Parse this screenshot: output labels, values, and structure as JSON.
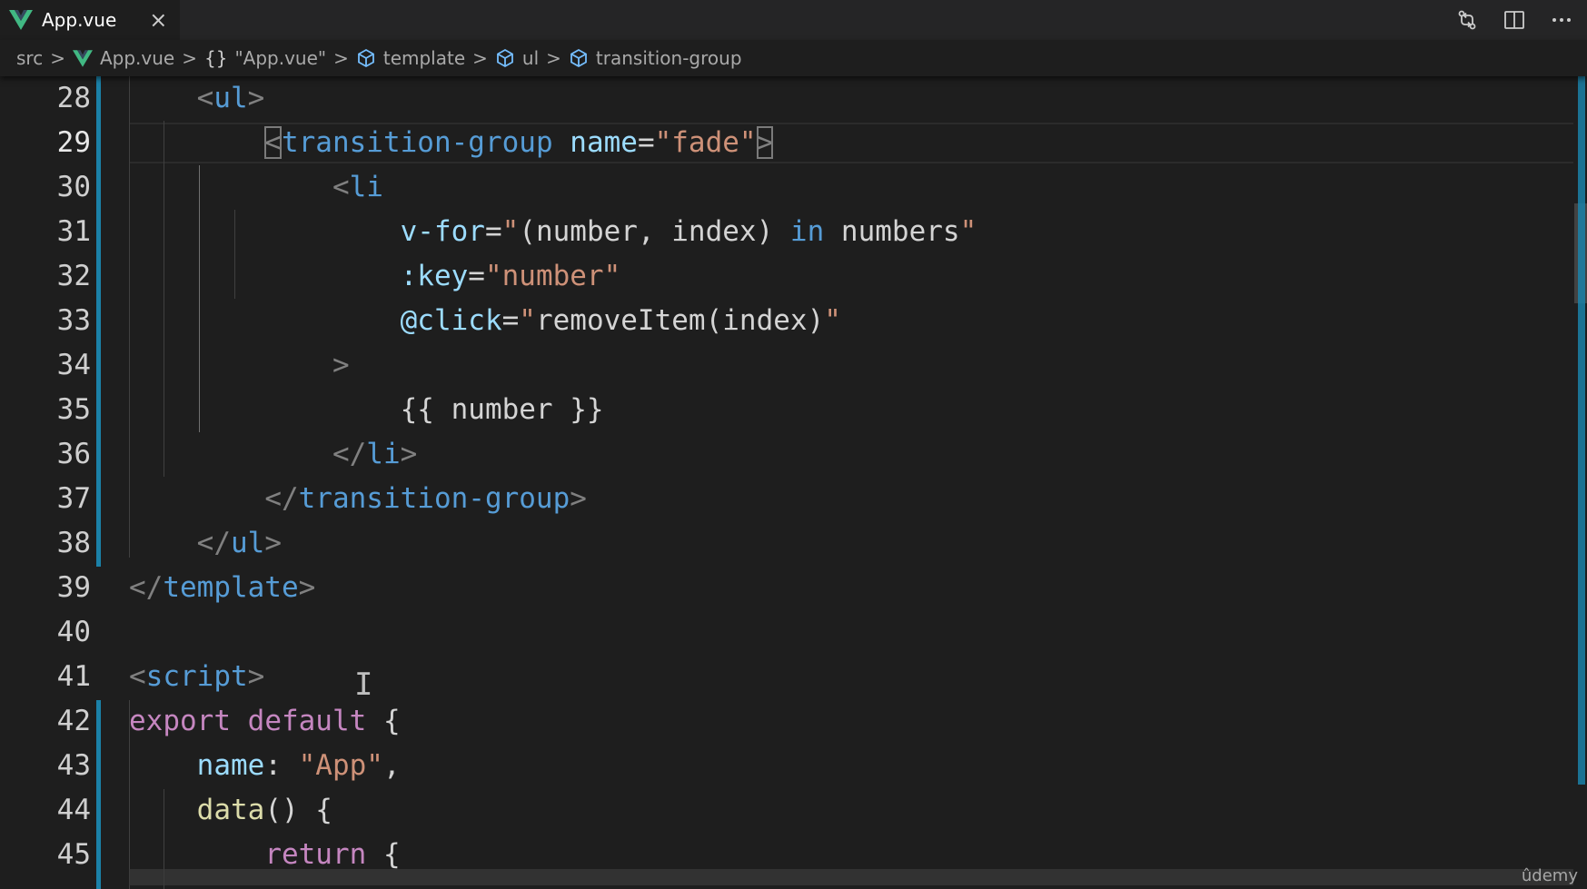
{
  "tab": {
    "filename": "App.vue",
    "close_glyph": "×"
  },
  "breadcrumb": {
    "items": [
      {
        "label": "src",
        "icon": ""
      },
      {
        "label": "App.vue",
        "icon": "vue-icon"
      },
      {
        "label": "\"App.vue\"",
        "icon": "braces-icon",
        "icon_text": "{}"
      },
      {
        "label": "template",
        "icon": "cube-icon"
      },
      {
        "label": "ul",
        "icon": "cube-icon"
      },
      {
        "label": "transition-group",
        "icon": "cube-icon"
      }
    ],
    "separator": ">"
  },
  "editor": {
    "line_numbers": [
      "28",
      "29",
      "30",
      "31",
      "32",
      "33",
      "34",
      "35",
      "36",
      "37",
      "38",
      "39",
      "40",
      "41",
      "42",
      "43",
      "44",
      "45"
    ],
    "active_line": "29",
    "lines": [
      {
        "indent": "  ",
        "tokens": [
          [
            "tg",
            "<"
          ],
          [
            "tn",
            "ul"
          ],
          [
            "tg",
            ">"
          ]
        ]
      },
      {
        "indent": "    ",
        "tokens": [
          [
            "tg",
            "<"
          ],
          [
            "tn",
            "transition-group"
          ],
          [
            "tx",
            " "
          ],
          [
            "at",
            "name"
          ],
          [
            "tx",
            "="
          ],
          [
            "st",
            "\"fade\""
          ],
          [
            "tg",
            ">"
          ]
        ]
      },
      {
        "indent": "      ",
        "tokens": [
          [
            "tg",
            "<"
          ],
          [
            "tn",
            "li"
          ]
        ]
      },
      {
        "indent": "        ",
        "tokens": [
          [
            "at",
            "v-for"
          ],
          [
            "tx",
            "="
          ],
          [
            "st",
            "\""
          ],
          [
            "tx",
            "(number, index) "
          ],
          [
            "bl",
            "in"
          ],
          [
            "tx",
            " numbers"
          ],
          [
            "st",
            "\""
          ]
        ]
      },
      {
        "indent": "        ",
        "tokens": [
          [
            "at",
            ":key"
          ],
          [
            "tx",
            "="
          ],
          [
            "st",
            "\"number\""
          ]
        ]
      },
      {
        "indent": "        ",
        "tokens": [
          [
            "at",
            "@click"
          ],
          [
            "tx",
            "="
          ],
          [
            "st",
            "\""
          ],
          [
            "tx",
            "removeItem(index)"
          ],
          [
            "st",
            "\""
          ]
        ]
      },
      {
        "indent": "      ",
        "tokens": [
          [
            "tg",
            ">"
          ]
        ]
      },
      {
        "indent": "        ",
        "tokens": [
          [
            "tx",
            "{{ number }}"
          ]
        ]
      },
      {
        "indent": "      ",
        "tokens": [
          [
            "tg",
            "</"
          ],
          [
            "tn",
            "li"
          ],
          [
            "tg",
            ">"
          ]
        ]
      },
      {
        "indent": "    ",
        "tokens": [
          [
            "tg",
            "</"
          ],
          [
            "tn",
            "transition-group"
          ],
          [
            "tg",
            ">"
          ]
        ]
      },
      {
        "indent": "  ",
        "tokens": [
          [
            "tg",
            "</"
          ],
          [
            "tn",
            "ul"
          ],
          [
            "tg",
            ">"
          ]
        ]
      },
      {
        "indent": "",
        "tokens": [
          [
            "tg",
            "</"
          ],
          [
            "tn",
            "template"
          ],
          [
            "tg",
            ">"
          ]
        ]
      },
      {
        "indent": "",
        "tokens": []
      },
      {
        "indent": "",
        "tokens": [
          [
            "tg",
            "<"
          ],
          [
            "tn",
            "script"
          ],
          [
            "tg",
            ">"
          ]
        ]
      },
      {
        "indent": "",
        "tokens": [
          [
            "kw",
            "export"
          ],
          [
            "tx",
            " "
          ],
          [
            "kw",
            "default"
          ],
          [
            "tx",
            " {"
          ]
        ]
      },
      {
        "indent": "  ",
        "tokens": [
          [
            "vr",
            "name"
          ],
          [
            "tx",
            ": "
          ],
          [
            "st",
            "\"App\""
          ],
          [
            "tx",
            ","
          ]
        ]
      },
      {
        "indent": "  ",
        "tokens": [
          [
            "fn",
            "data"
          ],
          [
            "tx",
            "() {"
          ]
        ]
      },
      {
        "indent": "    ",
        "tokens": [
          [
            "kw",
            "return"
          ],
          [
            "tx",
            " {"
          ]
        ]
      }
    ]
  },
  "colors": {
    "background": "#1e1e1e",
    "tag": "#569cd6",
    "attribute": "#9cdcfe",
    "string": "#ce9178",
    "keyword": "#c586c0",
    "function": "#dcdcaa",
    "vue_green": "#41b883",
    "change_bar": "#1b81a8"
  },
  "toolbar_icons": [
    "source-control-compare-icon",
    "split-editor-icon",
    "more-actions-icon"
  ],
  "watermark": "ûdemy"
}
